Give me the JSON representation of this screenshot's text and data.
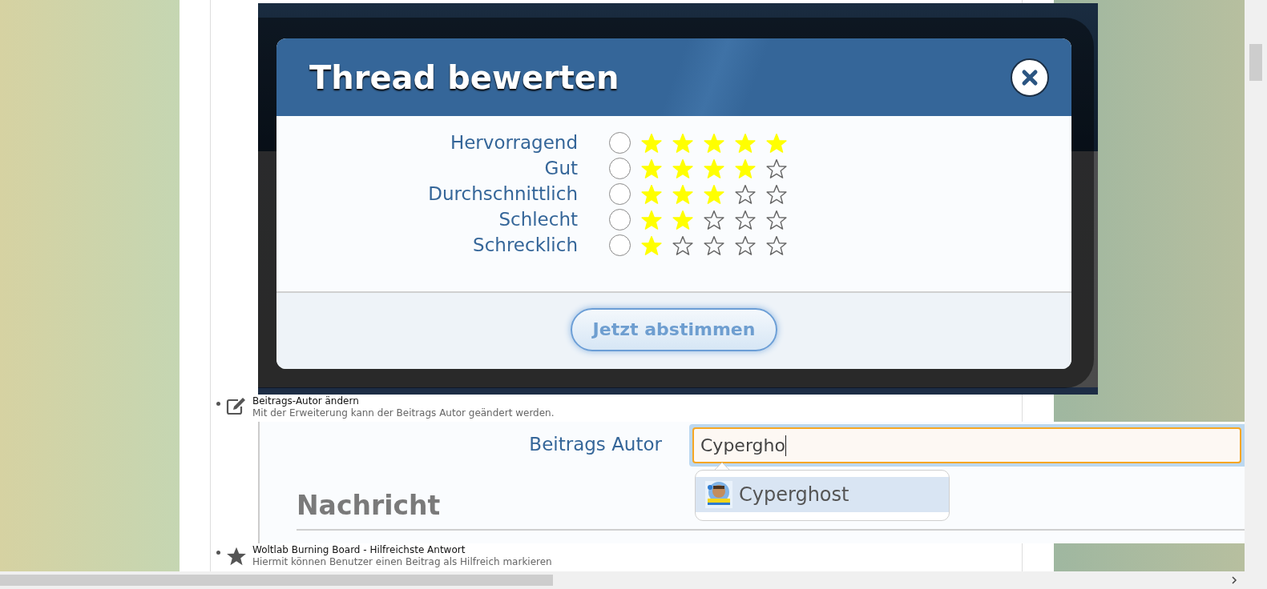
{
  "dialog": {
    "title": "Thread bewerten",
    "options": [
      {
        "label": "Hervorragend",
        "stars": 5,
        "selected": false
      },
      {
        "label": "Gut",
        "stars": 4,
        "selected": false
      },
      {
        "label": "Durchschnittlich",
        "stars": 3,
        "selected": false
      },
      {
        "label": "Schlecht",
        "stars": 2,
        "selected": false
      },
      {
        "label": "Schrecklich",
        "stars": 1,
        "selected": false
      }
    ],
    "submit_button": "Jetzt abstimmen"
  },
  "features": [
    {
      "kind": "edit",
      "title": "Beitrags-Autor ändern",
      "description": "Mit der Erweiterung kann der Beitrags Autor geändert werden."
    },
    {
      "kind": "star",
      "title": "Woltlab Burning Board - Hilfreichste Antwort",
      "description": "Hiermit können Benutzer einen Beitrag als Hilfreich markieren"
    }
  ],
  "author_form": {
    "label": "Beitrags Autor",
    "value": "Cypergho",
    "suggestions": [
      {
        "name": "Cyperghost",
        "selected": true
      }
    ],
    "section_heading": "Nachricht"
  }
}
